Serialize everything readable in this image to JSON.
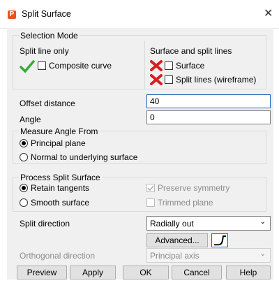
{
  "window": {
    "title": "Split Surface",
    "app_icon_letter": "P",
    "close_glyph": "✕"
  },
  "selection_mode": {
    "legend": "Selection Mode",
    "split_line_only": "Split line only",
    "surface_and_split_lines": "Surface and split lines",
    "composite_curve": "Composite curve",
    "surface": "Surface",
    "split_lines": "Split lines (wireframe)"
  },
  "offset": {
    "label": "Offset distance",
    "value": "40"
  },
  "angle": {
    "label": "Angle",
    "value": "0"
  },
  "measure_angle": {
    "legend": "Measure Angle From",
    "principal_plane": "Principal plane",
    "normal_surface": "Normal to underlying surface",
    "selected": "principal_plane"
  },
  "process_split": {
    "legend": "Process Split Surface",
    "retain_tangents": "Retain tangents",
    "smooth_surface": "Smooth surface",
    "preserve_symmetry": "Preserve symmetry",
    "trimmed_plane": "Trimmed plane"
  },
  "split_direction": {
    "label": "Split direction",
    "value": "Radially out",
    "advanced": "Advanced..."
  },
  "orthogonal": {
    "label": "Orthogonal direction",
    "value": "Principal axis"
  },
  "buttons": {
    "preview": "Preview",
    "apply": "Apply",
    "ok": "OK",
    "cancel": "Cancel",
    "help": "Help"
  },
  "colors": {
    "check_green": "#3aa935",
    "cross_red": "#d42020",
    "accent_blue": "#1e63b6",
    "app_icon": "#e8541c"
  }
}
